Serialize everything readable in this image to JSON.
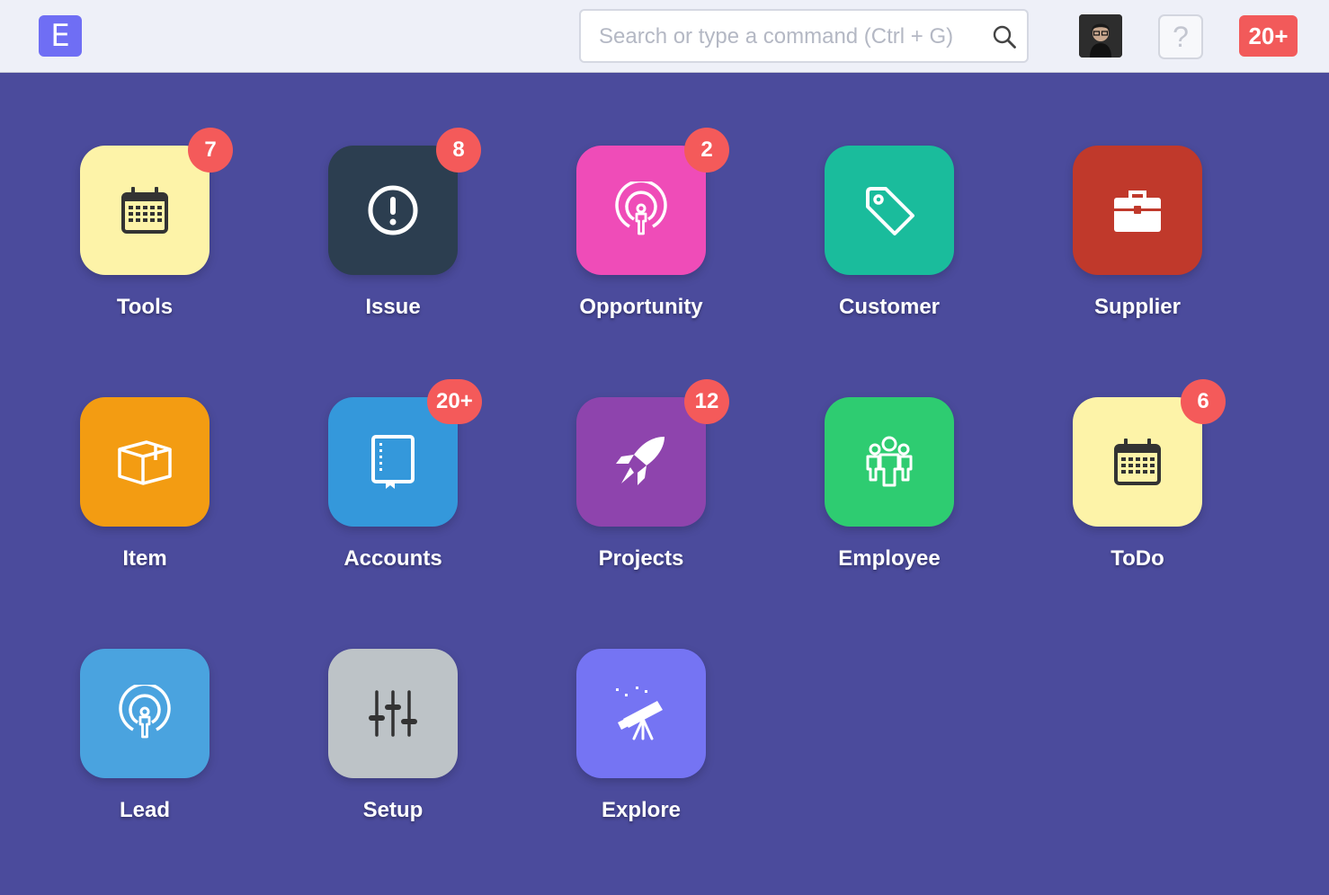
{
  "app": {
    "logo_letter": "E"
  },
  "search": {
    "placeholder": "Search or type a command (Ctrl + G)",
    "value": ""
  },
  "header": {
    "help_label": "?",
    "notification_count": "20+"
  },
  "modules": [
    {
      "label": "Tools",
      "badge": "7",
      "color": "#fdf3a8",
      "icon": "calendar-icon"
    },
    {
      "label": "Issue",
      "badge": "8",
      "color": "#2c3e50",
      "icon": "alert-circle-icon"
    },
    {
      "label": "Opportunity",
      "badge": "2",
      "color": "#ef4cb8",
      "icon": "broadcast-person-icon"
    },
    {
      "label": "Customer",
      "badge": "",
      "color": "#1abc9c",
      "icon": "tag-icon"
    },
    {
      "label": "Supplier",
      "badge": "",
      "color": "#c0392b",
      "icon": "briefcase-icon"
    },
    {
      "label": "Item",
      "badge": "",
      "color": "#f39c12",
      "icon": "box-icon"
    },
    {
      "label": "Accounts",
      "badge": "20+",
      "color": "#3498db",
      "icon": "book-icon"
    },
    {
      "label": "Projects",
      "badge": "12",
      "color": "#8e44ad",
      "icon": "rocket-icon"
    },
    {
      "label": "Employee",
      "badge": "",
      "color": "#2ecc71",
      "icon": "people-icon"
    },
    {
      "label": "ToDo",
      "badge": "6",
      "color": "#fdf3a8",
      "icon": "calendar-icon"
    },
    {
      "label": "Lead",
      "badge": "",
      "color": "#4aa3df",
      "icon": "broadcast-person-icon"
    },
    {
      "label": "Setup",
      "badge": "",
      "color": "#bdc3c7",
      "icon": "sliders-icon"
    },
    {
      "label": "Explore",
      "badge": "",
      "color": "#7574f3",
      "icon": "telescope-icon"
    }
  ]
}
